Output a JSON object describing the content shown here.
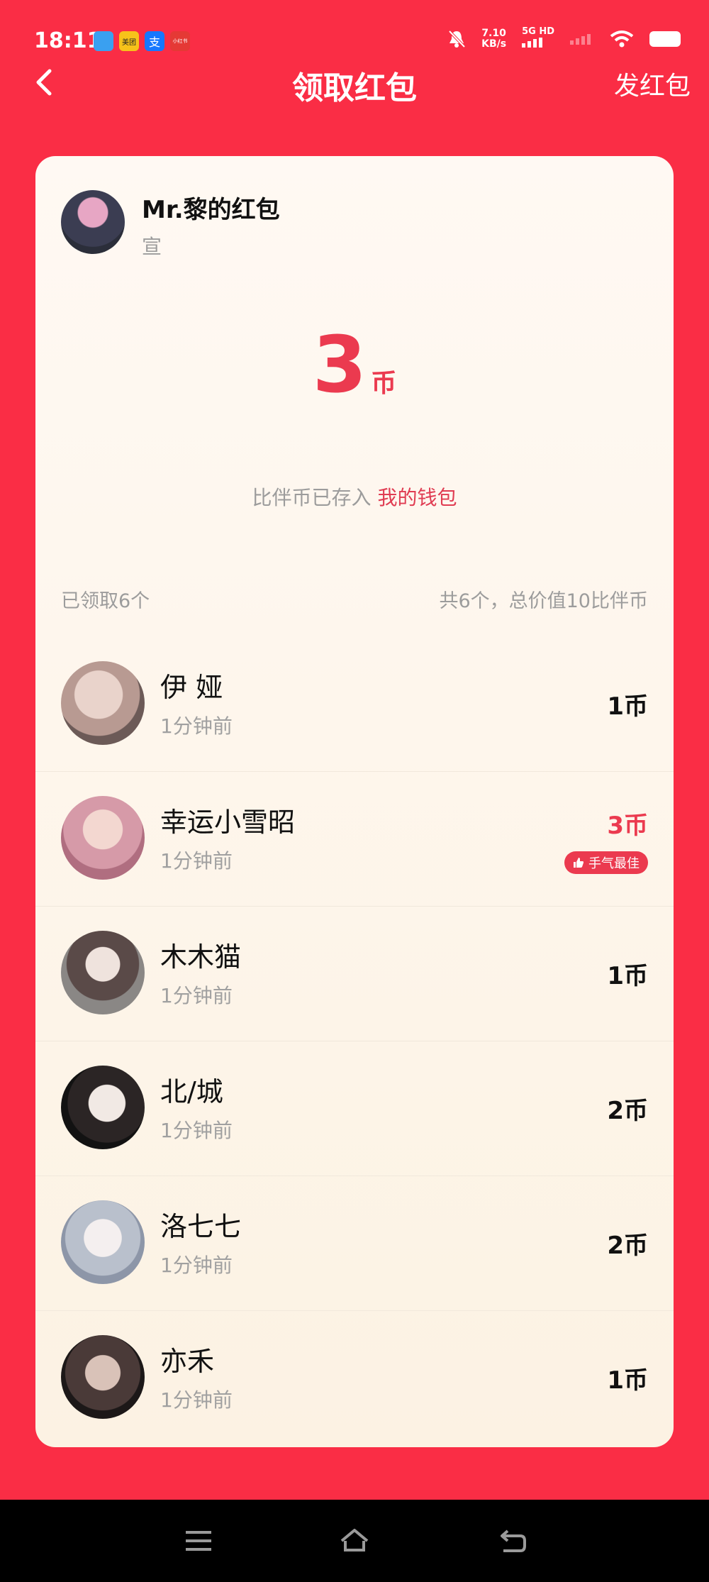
{
  "status": {
    "time": "18:11",
    "apps": [
      {
        "name": "app-blue",
        "label": "",
        "color": "#3AA0F0"
      },
      {
        "name": "meituan",
        "label": "美团",
        "color": "#F7C21A"
      },
      {
        "name": "alipay",
        "label": "支",
        "color": "#1677FF"
      },
      {
        "name": "mini-app",
        "label": "小红书",
        "color": "#E53935"
      }
    ],
    "net_speed_value": "7.10",
    "net_speed_unit": "KB/s",
    "network_type": "5G HD"
  },
  "header": {
    "title": "领取红包",
    "send_label": "发红包"
  },
  "sender": {
    "name": "Mr.黎的红包",
    "subtitle": "宣"
  },
  "my_amount": {
    "value": "3",
    "unit": "币"
  },
  "wallet": {
    "prefix": "比伴币已存入",
    "link": "我的钱包"
  },
  "summary": {
    "received": "已领取6个",
    "total": "共6个，总价值10比伴币"
  },
  "records": [
    {
      "name": "伊 娅",
      "time": "1分钟前",
      "amount": "1币"
    },
    {
      "name": "幸运小雪昭",
      "time": "1分钟前",
      "amount": "3币",
      "badge": "手气最佳"
    },
    {
      "name": "木木猫",
      "time": "1分钟前",
      "amount": "1币"
    },
    {
      "name": "北/城",
      "time": "1分钟前",
      "amount": "2币"
    },
    {
      "name": "洛七七",
      "time": "1分钟前",
      "amount": "2币"
    },
    {
      "name": "亦禾",
      "time": "1分钟前",
      "amount": "1币"
    }
  ],
  "colors": {
    "brand_red": "#FA2D45",
    "amount_red": "#EB3A4F",
    "card_bg": "#FFF9F3"
  }
}
